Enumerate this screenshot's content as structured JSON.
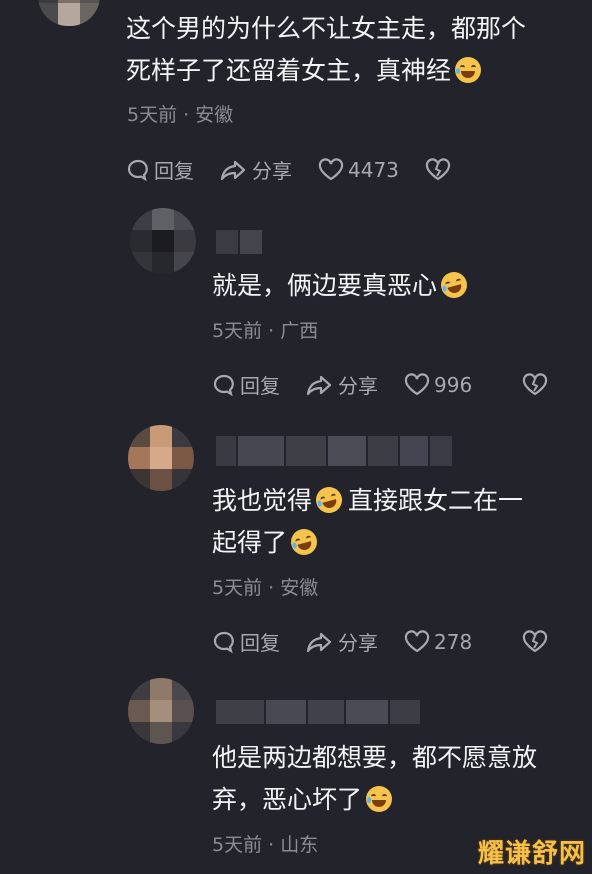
{
  "comments": [
    {
      "text_line1": "这个男的为什么不让女主走，都那个",
      "text_line2": "死样子了还留着女主，真神经",
      "meta": "5天前 · 安徽",
      "reply": "回复",
      "share": "分享",
      "likes": "4473"
    },
    {
      "text_line1": "就是，俩边要真恶心",
      "meta": "5天前 · 广西",
      "reply": "回复",
      "share": "分享",
      "likes": "996"
    },
    {
      "text_line1a": "我也觉得",
      "text_line1b": "直接跟女二在一",
      "text_line2": "起得了",
      "meta": "5天前 · 安徽",
      "reply": "回复",
      "share": "分享",
      "likes": "278"
    },
    {
      "text_line1": "他是两边都想要，都不愿意放",
      "text_line2": "弃，恶心坏了",
      "meta": "5天前 · 山东"
    }
  ],
  "watermark": "耀谦舒网",
  "colors": {
    "background": "#22232b",
    "text": "#f3f3f5",
    "meta": "#8b8c94",
    "actions": "#a7a8b0"
  }
}
